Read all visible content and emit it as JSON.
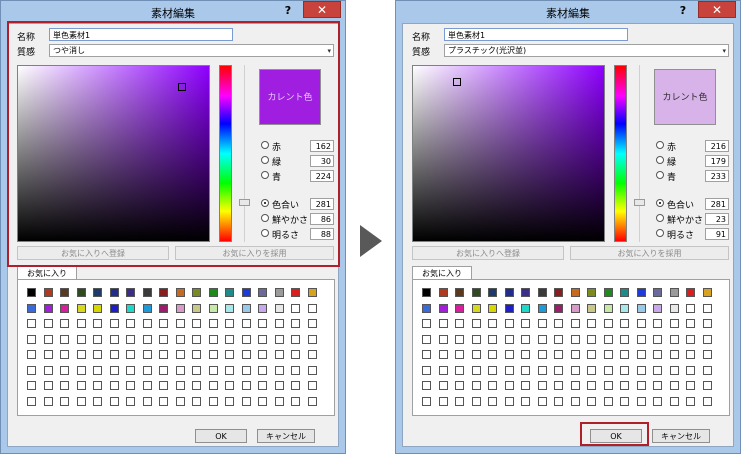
{
  "arrow_icon": "triangle-right-icon",
  "dialogs": [
    {
      "title": "素材編集",
      "help_label": "?",
      "close_label": "✕",
      "name_label": "名称",
      "name_value": "単色素材1",
      "texture_label": "質感",
      "texture_value": "つや消し",
      "current_color_label": "カレント色",
      "current_color": "#a01ee0",
      "hue_color": "#8e00ff",
      "sv_cursor": {
        "saturation": 0.86,
        "value": 0.88
      },
      "hue_value": 281,
      "red_label": "赤",
      "red_value": "162",
      "green_label": "緑",
      "green_value": "30",
      "blue_label": "青",
      "blue_value": "224",
      "hue_label": "色合い",
      "hue_text": "281",
      "sat_label": "鮮やかさ",
      "sat_value": "86",
      "bright_label": "明るさ",
      "bright_value": "88",
      "selected_radio": "hue",
      "add_fav_label": "お気に入りへ登録",
      "use_fav_label": "お気に入りを採用",
      "fav_tab_label": "お気に入り",
      "ok_label": "OK",
      "cancel_label": "キャンセル",
      "highlight": "picker"
    },
    {
      "title": "素材編集",
      "help_label": "?",
      "close_label": "✕",
      "name_label": "名称",
      "name_value": "単色素材1",
      "texture_label": "質感",
      "texture_value": "プラスチック(光沢並)",
      "current_color_label": "カレント色",
      "current_color": "#d8b3e9",
      "hue_color": "#8e00ff",
      "sv_cursor": {
        "saturation": 0.23,
        "value": 0.91
      },
      "hue_value": 281,
      "red_label": "赤",
      "red_value": "216",
      "green_label": "緑",
      "green_value": "179",
      "blue_label": "青",
      "blue_value": "233",
      "hue_label": "色合い",
      "hue_text": "281",
      "sat_label": "鮮やかさ",
      "sat_value": "23",
      "bright_label": "明るさ",
      "bright_value": "91",
      "selected_radio": "hue",
      "add_fav_label": "お気に入りへ登録",
      "use_fav_label": "お気に入りを採用",
      "fav_tab_label": "お気に入り",
      "ok_label": "OK",
      "cancel_label": "キャンセル",
      "highlight": "ok"
    }
  ],
  "favorites": {
    "rows": 8,
    "cols": 18,
    "swatches": [
      [
        "#000000",
        "#b03a1e",
        "#5a3a1e",
        "#2e4a1e",
        "#1e3a6a",
        "#1e2e8a",
        "#3a2e8a",
        "#3a3a3a",
        "#8a1e1e",
        "#c86a1e",
        "#7a8a1e",
        "#1e8a1e",
        "#1e8a8a",
        "#1e3ad8",
        "#6a6a9a",
        "#9a9a9a",
        "#d81e1e",
        "#d8a21e",
        "#c8d81e",
        "#8ad81e",
        "#1ed8d8"
      ],
      [
        "#3a6ad8",
        "#a21ed8",
        "#d81e9a",
        "#d8d81e",
        "#d8d800",
        "#1e1ec8",
        "#1ed8c8",
        "#1e9ad8",
        "#9a1e6a",
        "#d89ac8",
        "#c8c88a",
        "#c8e8a8",
        "#a8e8e8",
        "#9ac8e8",
        "#c8a8e8",
        "#e8e8e8"
      ]
    ]
  }
}
